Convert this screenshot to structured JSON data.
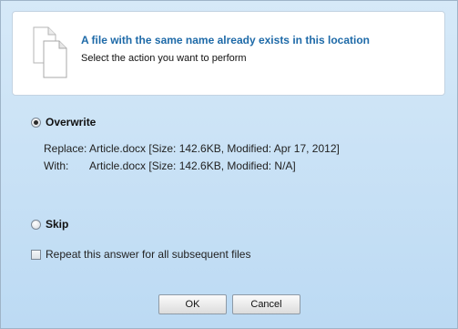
{
  "header": {
    "title": "A file with the same name already exists in this location",
    "subtitle": "Select the action you want to perform",
    "icon": "copy-files-icon"
  },
  "options": {
    "overwrite": {
      "label": "Overwrite",
      "selected": true
    },
    "skip": {
      "label": "Skip",
      "selected": false
    }
  },
  "details": {
    "replace_label": "Replace:",
    "replace_value": "Article.docx [Size: 142.6KB, Modified: Apr 17, 2012]",
    "with_label": "With:",
    "with_value": "Article.docx [Size: 142.6KB, Modified: N/A]"
  },
  "repeat": {
    "label": "Repeat this answer for all subsequent files",
    "checked": false
  },
  "buttons": {
    "ok": "OK",
    "cancel": "Cancel"
  },
  "colors": {
    "title": "#1e6aa8",
    "background_top": "#d6e9f8",
    "background_bottom": "#bcdaf3"
  }
}
